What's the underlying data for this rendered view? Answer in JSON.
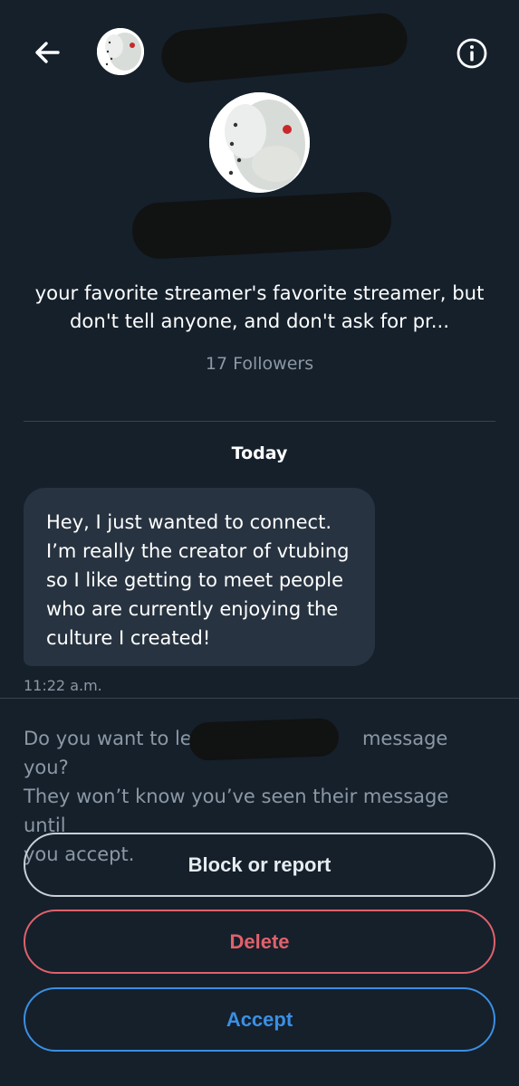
{
  "conversation": {
    "bio": "your favorite streamer's favorite streamer, but don't tell anyone, and don't ask for pr...",
    "followers_text": "17 Followers",
    "date_separator": "Today",
    "message": {
      "lines": [
        "Hey, I just wanted to connect.",
        "I’m really the creator of vtubing",
        "so I like getting to meet people",
        "who are currently enjoying the",
        "culture I created!"
      ],
      "timestamp": "11:22 a.m."
    }
  },
  "request": {
    "prompt_line_1a": "Do you want to let",
    "prompt_line_1b": "message you?",
    "prompt_line_2": "They won’t know you’ve seen their message until",
    "prompt_line_3": "you accept."
  },
  "actions": {
    "block_or_report": "Block or report",
    "delete": "Delete",
    "accept": "Accept"
  },
  "colors": {
    "background": "#15202b",
    "bubble": "#273340",
    "muted_text": "#8b98a5",
    "delete_red": "#e0616b",
    "accept_blue": "#3b8fe3"
  },
  "icons": {
    "back": "arrow-left-icon",
    "info": "info-circle-icon"
  }
}
